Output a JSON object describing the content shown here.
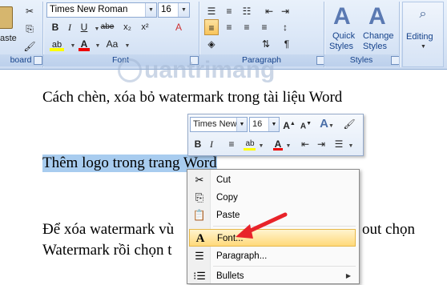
{
  "ribbon": {
    "groups": {
      "clipboard_label": "board",
      "font_label": "Font",
      "paragraph_label": "Paragraph",
      "styles_label": "Styles"
    },
    "paste_label": "aste",
    "font_name": "Times New Roman",
    "font_size": "16",
    "quick_styles_line1": "Quick",
    "quick_styles_line2": "Styles",
    "change_styles_line1": "Change",
    "change_styles_line2": "Styles",
    "editing_label": "Editing",
    "buttons": {
      "bold": "B",
      "italic": "I",
      "underline": "U",
      "strike": "abe",
      "subscript": "x₂",
      "superscript": "x²",
      "grow": "A",
      "shrink": "A",
      "change_case": "Aa",
      "clear": "A",
      "pilcrow": "¶"
    }
  },
  "document": {
    "line1": "Cách chèn, xóa bỏ watermark  trong tài liệu Word",
    "line2": "Thêm logo trong trang Word",
    "line3_a": "Để xóa watermark  vù",
    "line3_b": "out chọn",
    "line4": "Watermark rồi chọn t"
  },
  "watermark": {
    "text": "uantrimang"
  },
  "mini_toolbar": {
    "font_name": "Times New",
    "font_size": "16",
    "bold": "B",
    "italic": "I"
  },
  "context_menu": {
    "items": [
      {
        "label": "Cut",
        "icon": "scissors-icon"
      },
      {
        "label": "Copy",
        "icon": "copy-icon"
      },
      {
        "label": "Paste",
        "icon": "paste-icon"
      },
      {
        "label": "Font...",
        "icon": "font-icon"
      },
      {
        "label": "Paragraph...",
        "icon": "paragraph-icon"
      },
      {
        "label": "Bullets",
        "icon": "bullets-icon"
      }
    ]
  },
  "colors": {
    "highlight": "#a8ccef",
    "arrow": "#e8232a",
    "menu_hot": "#ffd97a",
    "ribbon_label": "#15428b"
  }
}
